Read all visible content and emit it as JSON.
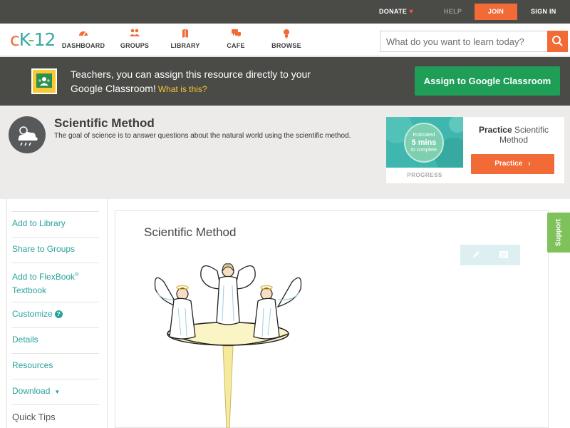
{
  "topbar": {
    "donate": "DONATE",
    "help": "HELP",
    "join": "JOIN",
    "signin": "SIGN IN"
  },
  "logo": {
    "c": "c",
    "k": "K",
    "dash": "-",
    "num": "12"
  },
  "nav": {
    "items": [
      {
        "label": "DASHBOARD",
        "icon": "dashboard-icon"
      },
      {
        "label": "GROUPS",
        "icon": "groups-icon"
      },
      {
        "label": "LIBRARY",
        "icon": "library-icon"
      },
      {
        "label": "CAFE",
        "icon": "cafe-icon"
      },
      {
        "label": "BROWSE",
        "icon": "browse-icon"
      }
    ]
  },
  "search": {
    "placeholder": "What do you want to learn today?"
  },
  "banner": {
    "text": "Teachers, you can assign this resource directly to your Google Classroom!",
    "what_is_this": "What is this?",
    "assign_label": "Assign to Google Classroom"
  },
  "concept": {
    "title": "Scientific Method",
    "description": "The goal of science is to answer questions about the natural world using the scientific method."
  },
  "practice": {
    "estimated": "Estimated",
    "mins": "5 mins",
    "to_complete": "to complete",
    "progress_label": "PROGRESS",
    "title_bold": "Practice",
    "title_rest": "Scientific Method",
    "button": "Practice"
  },
  "sidebar": {
    "add_library": "Add to Library",
    "share_groups": "Share to Groups",
    "add_flexbook": "Add to FlexBook",
    "reg": "®",
    "textbook": "Textbook",
    "customize": "Customize",
    "details": "Details",
    "resources": "Resources",
    "download": "Download",
    "quick_tips": "Quick Tips"
  },
  "main": {
    "title": "Scientific Method"
  },
  "support": "Support",
  "colors": {
    "brand_orange": "#f26a35",
    "teal": "#2aa39b",
    "google_green": "#1e9e57",
    "dark_bar": "#4a4a47",
    "support_green": "#7fc25c"
  }
}
